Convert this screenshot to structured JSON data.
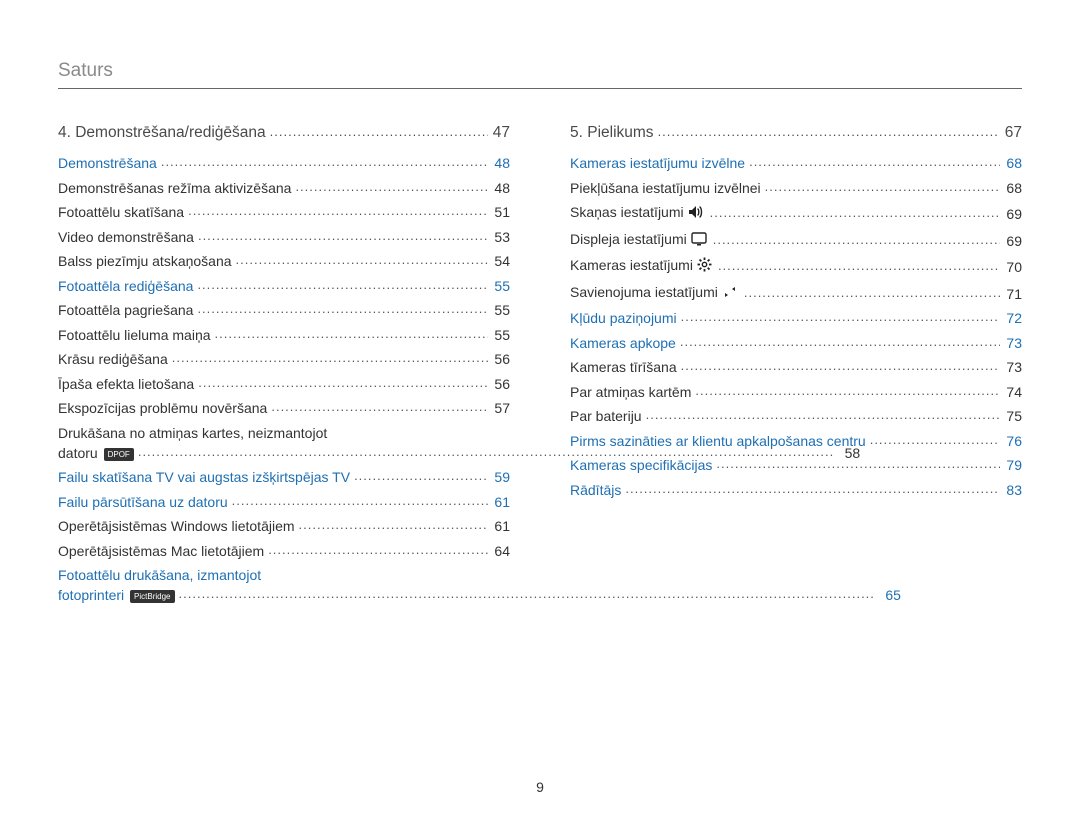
{
  "header": {
    "title": "Saturs"
  },
  "page_number": "9",
  "left": {
    "chapter": {
      "label": "4. Demonstrēšana/rediģēšana",
      "page": "47"
    },
    "sections": [
      {
        "label": "Demonstrēšana",
        "page": "48",
        "items": [
          {
            "label": "Demonstrēšanas režīma aktivizēšana",
            "page": "48"
          },
          {
            "label": "Fotoattēlu skatīšana",
            "page": "51"
          },
          {
            "label": "Video demonstrēšana",
            "page": "53"
          },
          {
            "label": "Balss piezīmju atskaņošana",
            "page": "54"
          }
        ]
      },
      {
        "label": "Fotoattēla rediģēšana",
        "page": "55",
        "items": [
          {
            "label": "Fotoattēla pagriešana",
            "page": "55"
          },
          {
            "label": "Fotoattēlu lieluma maiņa",
            "page": "55"
          },
          {
            "label": "Krāsu rediģēšana",
            "page": "56"
          },
          {
            "label": "Īpaša efekta lietošana",
            "page": "56"
          },
          {
            "label": "Ekspozīcijas problēmu novēršana",
            "page": "57"
          },
          {
            "label_line1": "Drukāšana no atmiņas kartes, neizmantojot",
            "label_line2": "datoru",
            "badge": "DPOF",
            "page": "58"
          }
        ]
      },
      {
        "label": "Failu skatīšana TV vai augstas izšķirtspējas TV",
        "page": "59",
        "items": []
      },
      {
        "label": "Failu pārsūtīšana uz datoru",
        "page": "61",
        "items": [
          {
            "label": "Operētājsistēmas Windows lietotājiem",
            "page": "61"
          },
          {
            "label": "Operētājsistēmas Mac lietotājiem",
            "page": "64"
          }
        ]
      },
      {
        "label_line1": "Fotoattēlu drukāšana, izmantojot",
        "label_line2": "fotoprinteri",
        "badge": "PictBridge",
        "page": "65",
        "items": []
      }
    ]
  },
  "right": {
    "chapter": {
      "label": "5. Pielikums",
      "page": "67"
    },
    "sections": [
      {
        "label": "Kameras iestatījumu izvēlne",
        "page": "68",
        "items": [
          {
            "label": "Piekļūšana iestatījumu izvēlnei",
            "page": "68"
          },
          {
            "label": "Skaņas iestatījumi",
            "icon": "sound",
            "page": "69"
          },
          {
            "label": "Displeja iestatījumi",
            "icon": "display",
            "page": "69"
          },
          {
            "label": "Kameras iestatījumi",
            "icon": "gear",
            "page": "70"
          },
          {
            "label": "Savienojuma iestatījumi",
            "icon": "connection",
            "page": "71"
          }
        ]
      },
      {
        "label": "Kļūdu paziņojumi",
        "page": "72",
        "items": []
      },
      {
        "label": "Kameras apkope",
        "page": "73",
        "items": [
          {
            "label": "Kameras tīrīšana",
            "page": "73"
          },
          {
            "label": "Par atmiņas kartēm",
            "page": "74"
          },
          {
            "label": "Par bateriju",
            "page": "75"
          }
        ]
      },
      {
        "label": "Pirms sazināties ar klientu apkalpošanas centru",
        "page": "76",
        "items": []
      },
      {
        "label": "Kameras specifikācijas",
        "page": "79",
        "items": []
      },
      {
        "label": "Rādītājs",
        "page": "83",
        "items": []
      }
    ]
  }
}
